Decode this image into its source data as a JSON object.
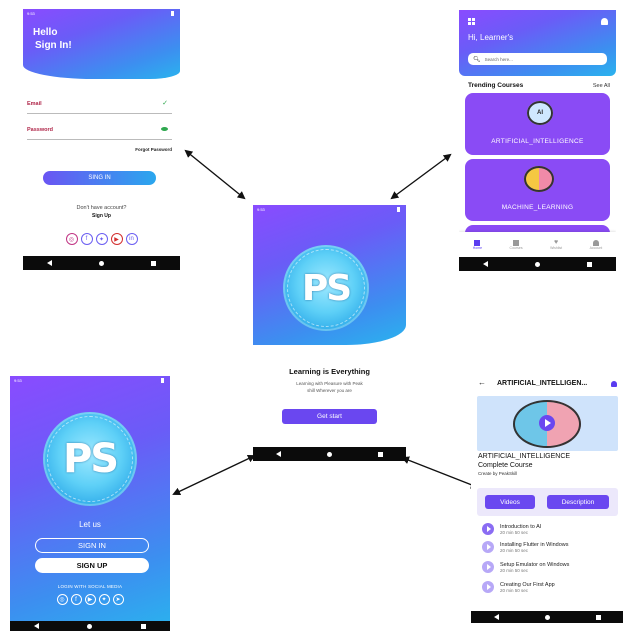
{
  "colors": {
    "primary": "#6a4cf5",
    "accent": "#2ab3ee",
    "email_label": "#b0274a",
    "check_green": "#2fa84f"
  },
  "signin_screen": {
    "status_time": "9:53",
    "greeting_line1": "Hello",
    "greeting_line2": "Sign In!",
    "email_label": "Email",
    "password_label": "Password",
    "forgot_password": "Forgot Password",
    "signin_button": "SING IN",
    "no_account": "Don't have account?",
    "signup_link": "Sign Up",
    "social_icons": [
      "instagram-icon",
      "facebook-icon",
      "twitter-icon",
      "youtube-icon",
      "linkedin-icon"
    ]
  },
  "home_screen": {
    "greeting": "Hi, Learner's",
    "search_placeholder": "Search here...",
    "section_title": "Trending Courses",
    "see_all": "See All",
    "courses": [
      {
        "title": "ARTIFICIAL_INTELLIGENCE",
        "icon": "ai-brain-icon"
      },
      {
        "title": "MACHINE_LEARNING",
        "icon": "ml-brain-icon"
      }
    ],
    "nav": [
      "Home",
      "Courses",
      "Wishlist",
      "Account"
    ]
  },
  "splash_screen": {
    "status_time": "9:53",
    "logo_text": "PS",
    "heading": "Learning is Everything",
    "subtitle_line1": "Learning with Pleasure with Peak",
    "subtitle_line2": "shill Wherever you are",
    "start_button": "Get start"
  },
  "welcome_screen": {
    "status_time": "9:53",
    "logo_text": "PS",
    "let_us": "Let us",
    "signin_button": "SIGN IN",
    "signup_button": "SIGN UP",
    "social_caption": "LOGIN WITH SOCIAL MEDIA",
    "social_icons": [
      "instagram-icon",
      "facebook-icon",
      "youtube-icon",
      "twitter-icon",
      "telegram-icon"
    ]
  },
  "course_screen": {
    "header_title": "ARTIFICIAL_INTELLIGEN...",
    "course_title_line1": "ARTIFICIAL_INTELLIGENCE",
    "course_title_line2": "Complete Course",
    "created_by": "Create by PeakSkill",
    "tab_videos": "Videos",
    "tab_description": "Description",
    "lessons": [
      {
        "title": "Introduction to AI",
        "duration": "20 min 50 sec"
      },
      {
        "title": "Installing Flutter in Windows",
        "duration": "20 min 50 sec"
      },
      {
        "title": "Setup Emulator on Windows",
        "duration": "20 min 50 sec"
      },
      {
        "title": "Creating Our First App",
        "duration": "20 min 50 sec"
      }
    ]
  }
}
